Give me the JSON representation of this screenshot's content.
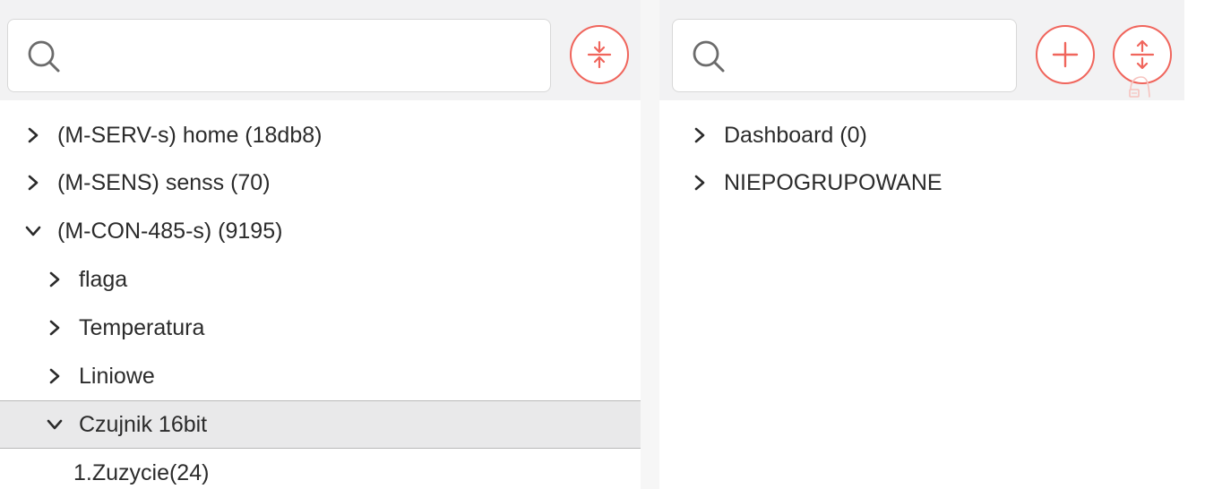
{
  "left_panel": {
    "search": {
      "placeholder": "",
      "value": ""
    },
    "collapse_all_icon": "collapse-vertical-icon",
    "tree": [
      {
        "label": "(M-SERV-s) home (18db8)",
        "expanded": false
      },
      {
        "label": "(M-SENS) senss (70)",
        "expanded": false
      },
      {
        "label": "(M-CON-485-s) (9195)",
        "expanded": true
      },
      {
        "label": "flaga",
        "expanded": false
      },
      {
        "label": "Temperatura",
        "expanded": false
      },
      {
        "label": "Liniowe",
        "expanded": false
      },
      {
        "label": "Czujnik 16bit",
        "expanded": true,
        "selected": true
      },
      {
        "label": "1.Zuzycie(24)"
      }
    ]
  },
  "right_panel": {
    "search": {
      "placeholder": "",
      "value": ""
    },
    "add_icon": "plus-icon",
    "expand_all_icon": "expand-vertical-icon",
    "tree": [
      {
        "label": "Dashboard (0)",
        "expanded": false
      },
      {
        "label": "NIEPOGRUPOWANE",
        "expanded": false
      }
    ],
    "trash_icon": "trash-icon"
  },
  "colors": {
    "accent": "#f0655c",
    "topbar_bg": "#f2f2f3",
    "selected_row_bg": "#e9e9ea"
  }
}
